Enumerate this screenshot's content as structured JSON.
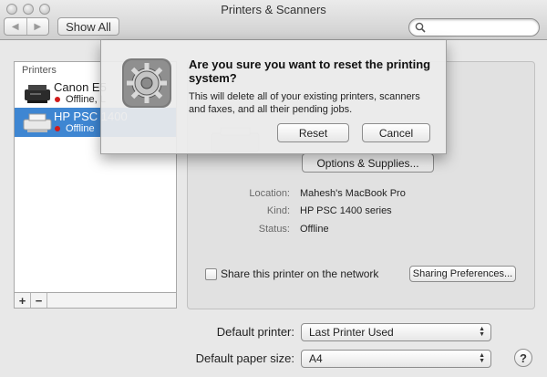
{
  "window": {
    "title": "Printers & Scanners",
    "show_all_label": "Show All",
    "search_placeholder": ""
  },
  "printers": {
    "header": "Printers",
    "items": [
      {
        "name": "Canon E5",
        "status": "Offline, L",
        "selected": false
      },
      {
        "name": "HP PSC 1400",
        "status": "Offline",
        "selected": true
      }
    ],
    "add_label": "+",
    "remove_label": "−"
  },
  "detail": {
    "options_supplies_label": "Options & Supplies...",
    "location_label": "Location:",
    "location_value": "Mahesh's MacBook Pro",
    "kind_label": "Kind:",
    "kind_value": "HP PSC 1400 series",
    "status_label": "Status:",
    "status_value": "Offline",
    "share_label": "Share this printer on the network",
    "share_checked": false,
    "sharing_prefs_label": "Sharing Preferences..."
  },
  "defaults": {
    "printer_label": "Default printer:",
    "printer_value": "Last Printer Used",
    "paper_label": "Default paper size:",
    "paper_value": "A4"
  },
  "help_label": "?",
  "dialog": {
    "title": "Are you sure you want to reset the printing system?",
    "message": "This will delete all of your existing printers, scanners and faxes, and all their pending jobs.",
    "reset_label": "Reset",
    "cancel_label": "Cancel"
  },
  "colors": {
    "selection": "#3e86d2",
    "status_offline": "#d11b1b"
  }
}
